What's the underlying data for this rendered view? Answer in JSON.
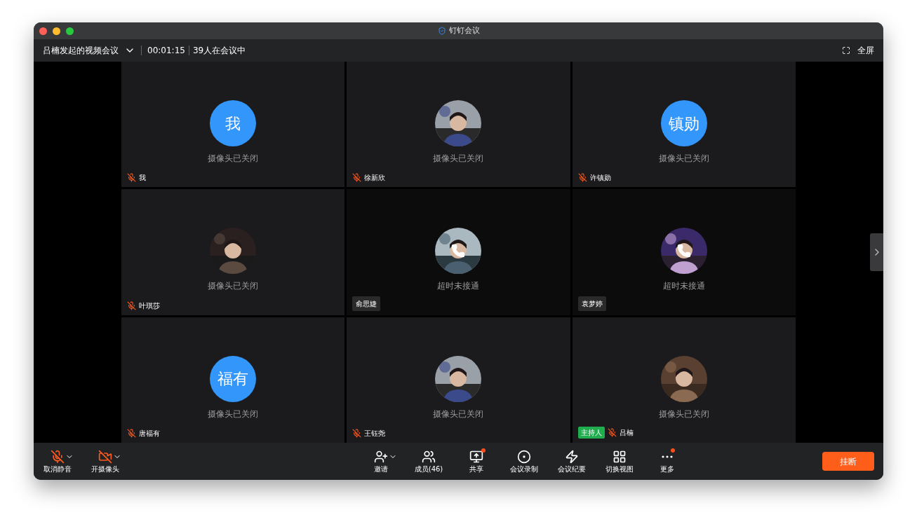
{
  "window": {
    "title": "钉钉会议"
  },
  "header": {
    "meeting_title": "吕楠发起的视频会议",
    "duration": "00:01:15",
    "attendance": "39人在会议中",
    "fullscreen": "全屏"
  },
  "tiles": [
    {
      "kind": "text",
      "avatar_text": "我",
      "status": "摄像头已关闭",
      "name": "我",
      "muted": true,
      "calling": false
    },
    {
      "status": "摄像头已关闭",
      "name": "徐新欣",
      "muted": true,
      "calling": false
    },
    {
      "kind": "text",
      "avatar_text": "镇勋",
      "status": "摄像头已关闭",
      "name": "许镇勋",
      "muted": true,
      "calling": false
    },
    {
      "status": "摄像头已关闭",
      "name": "叶琪莎",
      "muted": true,
      "calling": false
    },
    {
      "status": "超时未接通",
      "name": "俞思婕",
      "muted": false,
      "calling": true
    },
    {
      "status": "超时未接通",
      "name": "袁梦婷",
      "muted": false,
      "calling": true
    },
    {
      "kind": "text",
      "avatar_text": "福有",
      "status": "摄像头已关闭",
      "name": "唐福有",
      "muted": true,
      "calling": false
    },
    {
      "status": "摄像头已关闭",
      "name": "王钰尧",
      "muted": true,
      "calling": false
    },
    {
      "status": "摄像头已关闭",
      "name": "吕楠",
      "muted": true,
      "calling": false,
      "badge": "主持人"
    }
  ],
  "toolbar_left": [
    {
      "kind": "mic",
      "label": "取消静音",
      "caret": true
    },
    {
      "kind": "camera",
      "label": "开摄像头",
      "caret": true
    }
  ],
  "toolbar_center": [
    {
      "kind": "invite",
      "label": "邀请",
      "caret": true,
      "dot": false
    },
    {
      "kind": "members",
      "label": "成员(46)",
      "caret": false,
      "dot": false
    },
    {
      "kind": "share",
      "label": "共享",
      "caret": false,
      "dot": true
    },
    {
      "kind": "record",
      "label": "会议录制",
      "caret": false,
      "dot": false
    },
    {
      "kind": "minutes",
      "label": "会议纪要",
      "caret": false,
      "dot": false
    },
    {
      "kind": "layout",
      "label": "切换视图",
      "caret": false,
      "dot": false
    },
    {
      "kind": "more",
      "label": "更多",
      "caret": false,
      "dot": true
    }
  ],
  "hangup": "挂断"
}
